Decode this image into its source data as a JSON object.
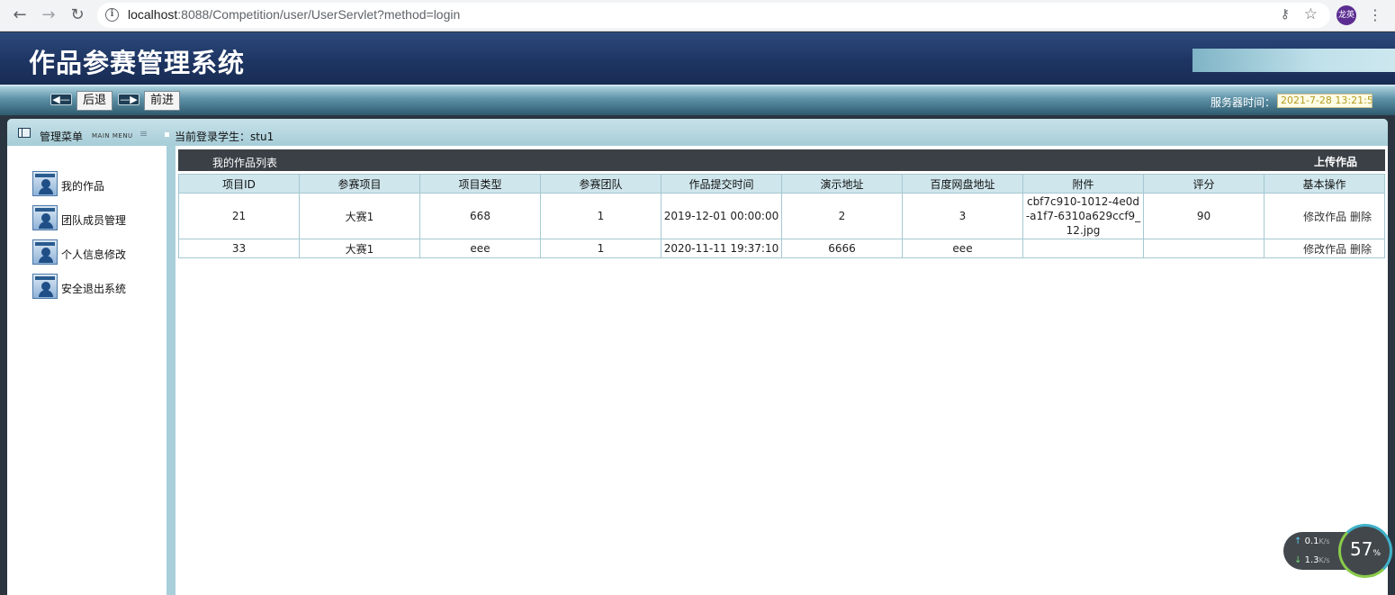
{
  "browser": {
    "url_host": "localhost",
    "url_path": ":8088/Competition/user/UserServlet?method=login",
    "avatar_text": "龙英",
    "back_glyph": "←",
    "forward_glyph": "→",
    "reload_glyph": "↻",
    "info_glyph": "i",
    "key_glyph": "⚷",
    "star_glyph": "☆",
    "menu_glyph": "⋮"
  },
  "app": {
    "title": "作品参赛管理系统"
  },
  "toolbar": {
    "back_label": "后退",
    "forward_label": "前进",
    "server_time_label": "服务器时间：",
    "server_time_value": "2021-7-28 13:21:5"
  },
  "topbar": {
    "menu_title": "管理菜单",
    "menu_subtitle": "MAIN MENU",
    "login_text": "当前登录学生：stu1"
  },
  "sidebar": {
    "items": [
      {
        "label": "我的作品"
      },
      {
        "label": "团队成员管理"
      },
      {
        "label": "个人信息修改"
      },
      {
        "label": "安全退出系统"
      }
    ]
  },
  "main": {
    "list_title": "我的作品列表",
    "upload_label": "上传作品",
    "columns": [
      "项目ID",
      "参赛项目",
      "项目类型",
      "参赛团队",
      "作品提交时间",
      "演示地址",
      "百度网盘地址",
      "附件",
      "评分",
      "基本操作"
    ],
    "rows": [
      {
        "id": "21",
        "project": "大赛1",
        "type": "668",
        "team": "1",
        "submit_time": "2019-12-01 00:00:00",
        "demo": "2",
        "pan": "3",
        "attachment": "cbf7c910-1012-4e0d-a1f7-6310a629ccf9_12.jpg",
        "score": "90",
        "edit": "修改作品",
        "delete": "删除"
      },
      {
        "id": "33",
        "project": "大赛1",
        "type": "eee",
        "team": "1",
        "submit_time": "2020-11-11 19:37:10",
        "demo": "6666",
        "pan": "eee",
        "attachment": "",
        "score": "",
        "edit": "修改作品",
        "delete": "删除"
      }
    ]
  },
  "widget": {
    "up_speed": "0.1",
    "down_speed": "1.3",
    "speed_unit": "K/s",
    "cpu_value": "57",
    "cpu_unit": "%",
    "up_glyph": "↑",
    "down_glyph": "↓"
  }
}
